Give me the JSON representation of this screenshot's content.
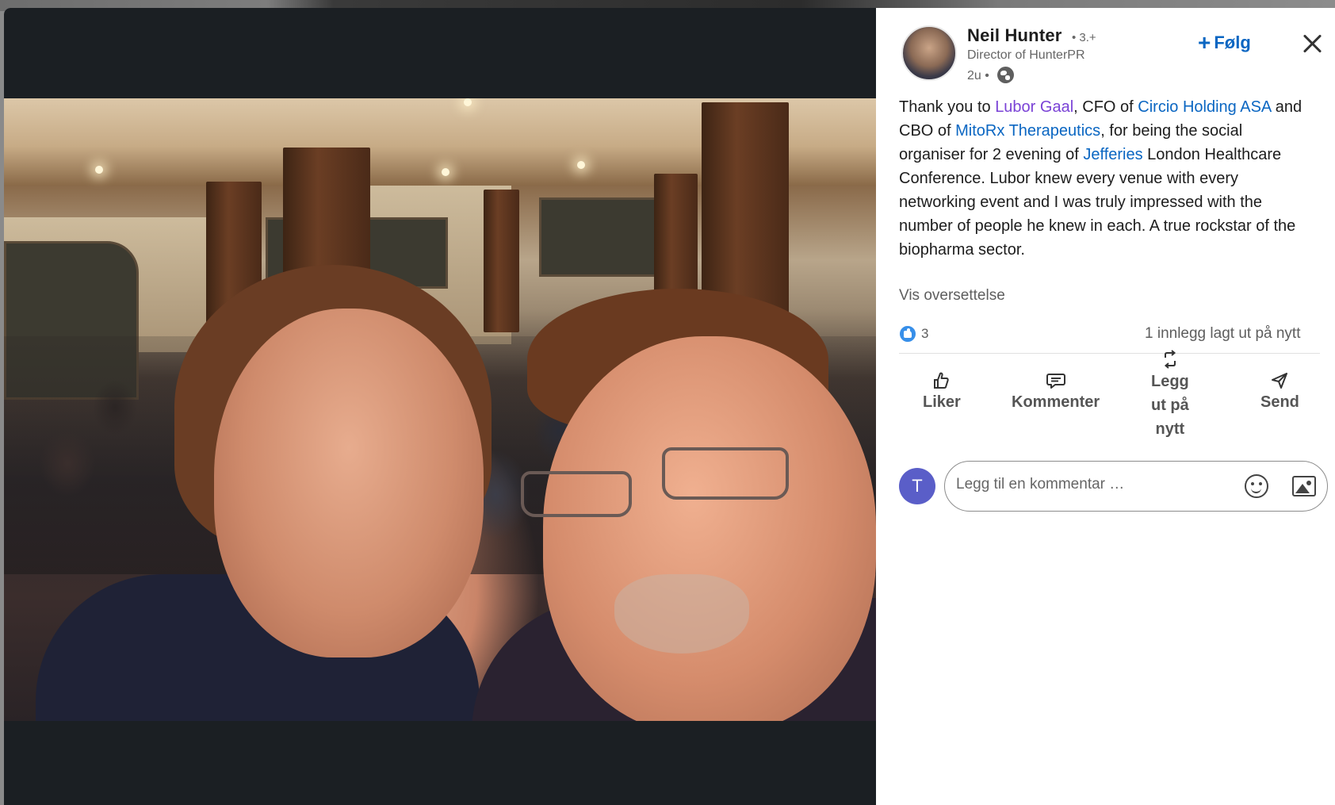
{
  "author": {
    "name": "Neil Hunter",
    "degree": "• 3.+",
    "headline": "Director of HunterPR",
    "time": "2u •"
  },
  "actions_top": {
    "follow_label": "Følg",
    "follow_plus": "+"
  },
  "post": {
    "segments": [
      {
        "text": "Thank you to ",
        "type": "plain"
      },
      {
        "text": "Lubor Gaal",
        "type": "person"
      },
      {
        "text": ", CFO of ",
        "type": "plain"
      },
      {
        "text": "Circio Holding ASA",
        "type": "org"
      },
      {
        "text": " and CBO of ",
        "type": "plain"
      },
      {
        "text": "MitoRx Therapeutics",
        "type": "org"
      },
      {
        "text": ", for being the social organiser for 2 evening of ",
        "type": "plain"
      },
      {
        "text": "Jefferies",
        "type": "org"
      },
      {
        "text": " London Healthcare Conference. Lubor knew every venue with every networking event and I was truly impressed with the number of people he knew in each. A true rockstar of the biopharma sector.",
        "type": "plain"
      }
    ],
    "translate_label": "Vis oversettelse"
  },
  "social": {
    "reaction_count": "3",
    "reposts": "1 innlegg lagt ut på nytt"
  },
  "action_bar": {
    "like": "Liker",
    "comment": "Kommenter",
    "repost": [
      "Legg",
      "ut på",
      "nytt"
    ],
    "send": "Send"
  },
  "comment": {
    "avatar_initial": "T",
    "placeholder": "Legg til en kommentar …"
  },
  "colors": {
    "accent": "#0a66c2",
    "person_mention": "#7a42d6",
    "viewer_bg": "#1b1f23",
    "avatar_bg": "#5a5ec8"
  },
  "icons": [
    "close-icon",
    "plus-icon",
    "globe-icon",
    "like-icon",
    "comment-icon",
    "repost-icon",
    "send-icon",
    "emoji-icon",
    "image-icon"
  ]
}
